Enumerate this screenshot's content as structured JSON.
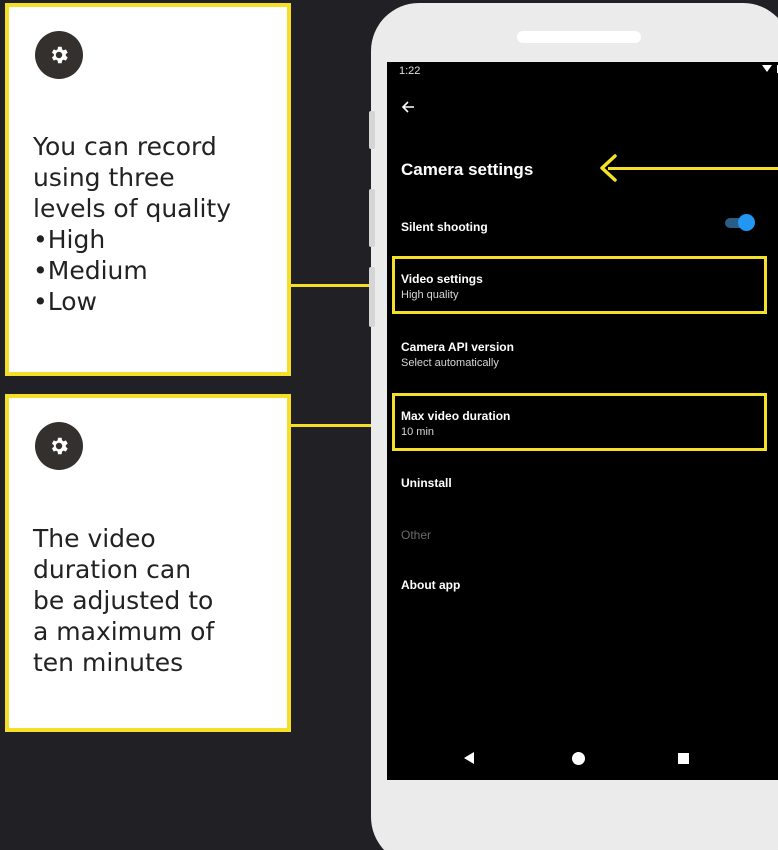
{
  "callouts": {
    "quality": {
      "icon": "gear-icon",
      "lines": [
        "You can record",
        "using three",
        "levels of quality"
      ],
      "bullets": [
        "High",
        "Medium",
        "Low"
      ]
    },
    "duration": {
      "icon": "gear-icon",
      "lines": [
        "The video",
        "duration can",
        "be adjusted to",
        "a maximum of",
        "ten minutes"
      ]
    }
  },
  "phone": {
    "status_time": "1:22",
    "status_icons": "wifi-icon battery-icon",
    "back_icon": "arrow-left-icon",
    "title": "Camera settings",
    "settings": {
      "silent_shooting": {
        "label": "Silent shooting",
        "toggle_on": true
      },
      "video_settings": {
        "label": "Video settings",
        "value": "High quality"
      },
      "camera_api": {
        "label": "Camera API version",
        "value": "Select automatically"
      },
      "max_duration": {
        "label": "Max video duration",
        "value": "10 min"
      },
      "uninstall": {
        "label": "Uninstall"
      },
      "other": {
        "label": "Other"
      },
      "about": {
        "label": "About app"
      }
    },
    "nav_icons": [
      "nav-back-icon",
      "nav-home-icon",
      "nav-recent-icon"
    ]
  },
  "colors": {
    "background": "#212024",
    "highlight": "#f5e027",
    "toggle_on": "#2196f3"
  }
}
